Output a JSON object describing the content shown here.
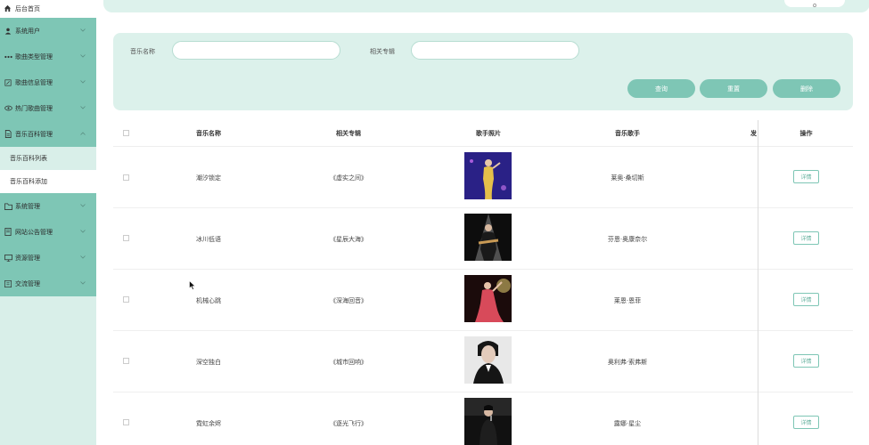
{
  "sidebar": {
    "home": "后台首页",
    "items": [
      {
        "label": "系统用户",
        "icon": "user-icon"
      },
      {
        "label": "歌曲类型管理",
        "icon": "dots-icon"
      },
      {
        "label": "歌曲信息管理",
        "icon": "edit-icon"
      },
      {
        "label": "热门歌曲管理",
        "icon": "eye-icon"
      },
      {
        "label": "音乐百科管理",
        "icon": "document-icon"
      },
      {
        "label": "系统管理",
        "icon": "folder-icon"
      },
      {
        "label": "网站公告管理",
        "icon": "notice-icon"
      },
      {
        "label": "资源管理",
        "icon": "monitor-icon"
      },
      {
        "label": "交流管理",
        "icon": "chat-icon"
      }
    ],
    "submenu": [
      "音乐百科列表",
      "音乐百科添加"
    ]
  },
  "search": {
    "music_name_label": "音乐名称",
    "music_name_value": "",
    "album_label": "相关专辑",
    "album_value": "",
    "query_btn": "查询",
    "reset_btn": "重置",
    "delete_btn": "删除"
  },
  "table": {
    "headers": [
      "音乐名称",
      "相关专辑",
      "歌手照片",
      "音乐歌手",
      "发",
      "操作"
    ],
    "detail_label": "详情",
    "rows": [
      {
        "name": "潮汐锁定",
        "album": "《虚实之间》",
        "singer": "莱奥·桑切斯"
      },
      {
        "name": "冰川低语",
        "album": "《星辰大海》",
        "singer": "芬恩·奥康奈尔"
      },
      {
        "name": "机械心跳",
        "album": "《深海回音》",
        "singer": "莱恩·恩菲"
      },
      {
        "name": "深空独白",
        "album": "《城市回响》",
        "singer": "奥利弗·索弗斯"
      },
      {
        "name": "霓虹余烬",
        "album": "《逐光飞行》",
        "singer": "露娜·星尘"
      }
    ]
  },
  "colors": {
    "accent": "#7ec6b5",
    "panel": "#dcf1eb",
    "sidebar_bg": "#d9efe9"
  }
}
